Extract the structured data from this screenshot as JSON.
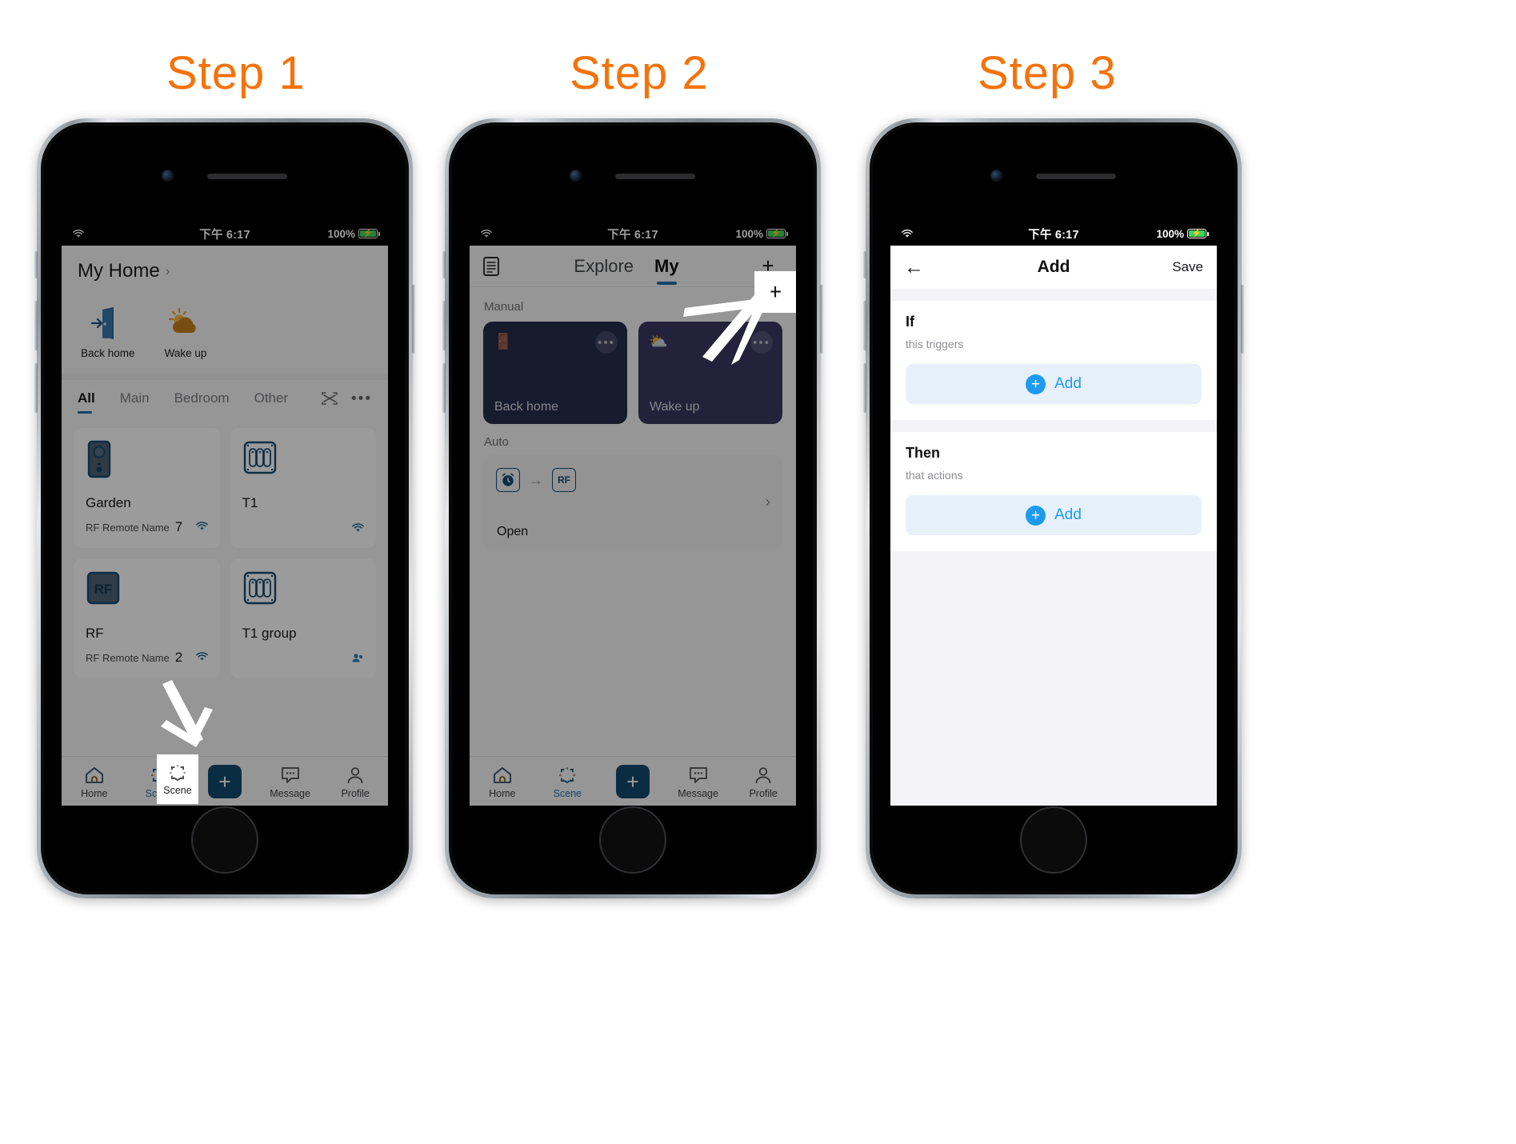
{
  "steps": [
    {
      "label": "Step 1"
    },
    {
      "label": "Step 2"
    },
    {
      "label": "Step 3"
    }
  ],
  "accent_color": "#f4730c",
  "status_bar": {
    "time": "下午 6:17",
    "battery_pct": "100%",
    "wifi_icon": "wifi-icon",
    "battery_icon": "battery-charging-icon"
  },
  "step1": {
    "home_name": "My Home",
    "chevron": "›",
    "quick_scenes": [
      {
        "label": "Back home",
        "icon": "door-exit-icon"
      },
      {
        "label": "Wake up",
        "icon": "sun-cloud-icon"
      }
    ],
    "tabs": [
      {
        "label": "All",
        "active": true
      },
      {
        "label": "Main",
        "active": false
      },
      {
        "label": "Bedroom",
        "active": false
      },
      {
        "label": "Other",
        "active": false
      }
    ],
    "tabs_right_icons": [
      "scan-icon",
      "more-icon"
    ],
    "devices": [
      {
        "name": "Garden",
        "sub": "RF Remote Name",
        "num": "7",
        "icon": "rf-remote-icon",
        "status_icon": "wifi-icon"
      },
      {
        "name": "T1",
        "sub": "",
        "num": "",
        "icon": "switch-panel-icon",
        "status_icon": "wifi-icon"
      },
      {
        "name": "RF",
        "sub": "RF Remote Name",
        "num": "2",
        "icon": "rf-badge-icon",
        "status_icon": "wifi-icon"
      },
      {
        "name": "T1 group",
        "sub": "",
        "num": "",
        "icon": "switch-panel-icon",
        "status_icon": "group-icon"
      }
    ],
    "tabbar": [
      {
        "label": "Home",
        "icon": "home-icon",
        "selected": false
      },
      {
        "label": "Scene",
        "icon": "scene-hex-icon",
        "selected": true,
        "highlighted": true
      },
      {
        "label": "",
        "icon": "plus-square-icon",
        "selected": false
      },
      {
        "label": "Message",
        "icon": "message-icon",
        "selected": false
      },
      {
        "label": "Profile",
        "icon": "profile-icon",
        "selected": false
      }
    ]
  },
  "step2": {
    "list_icon": "list-doc-icon",
    "tabs": [
      {
        "label": "Explore",
        "active": false
      },
      {
        "label": "My",
        "active": true
      }
    ],
    "plus_label": "+",
    "plus_highlighted": true,
    "sections": [
      {
        "title": "Manual",
        "sort_icon": "sort-icon"
      },
      {
        "title": "Auto",
        "sort_icon": ""
      }
    ],
    "manual_scenes": [
      {
        "name": "Back home",
        "emoji": "🚪",
        "color": "#252c4a",
        "more": "•••"
      },
      {
        "name": "Wake up",
        "emoji": "⛅",
        "color": "#3a3660",
        "more": "•••"
      }
    ],
    "auto_scenes": [
      {
        "name": "Open",
        "trigger_icon": "alarm-clock-icon",
        "arrow": "→",
        "action_icon": "RF",
        "chevron": "›"
      }
    ],
    "tabbar": [
      {
        "label": "Home",
        "icon": "home-icon",
        "selected": false
      },
      {
        "label": "Scene",
        "icon": "scene-hex-icon",
        "selected": true
      },
      {
        "label": "",
        "icon": "plus-square-icon",
        "selected": false
      },
      {
        "label": "Message",
        "icon": "message-icon",
        "selected": false
      },
      {
        "label": "Profile",
        "icon": "profile-icon",
        "selected": false
      }
    ]
  },
  "step3": {
    "back_icon": "arrow-left-icon",
    "title": "Add",
    "save_label": "Save",
    "groups": [
      {
        "heading": "If",
        "sub": "this triggers",
        "button_label": "Add",
        "button_icon": "plus-circle-icon"
      },
      {
        "heading": "Then",
        "sub": "that actions",
        "button_label": "Add",
        "button_icon": "plus-circle-icon"
      }
    ]
  }
}
